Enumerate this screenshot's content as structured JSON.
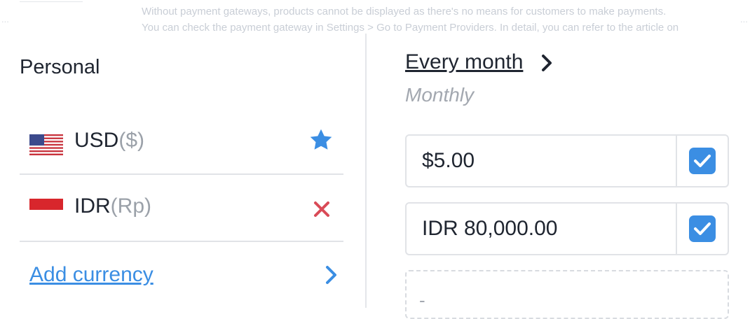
{
  "background": {
    "line1": "Without payment gateways, products cannot be displayed as there's no means for customers to make payments.",
    "line2": "You can check the payment gateway in Settings > Go to Payment Providers. In detail, you can refer to the article on",
    "left_fragment": "...",
    "right_fragment": "..."
  },
  "currencies": {
    "section_title": "Personal",
    "items": [
      {
        "code": "USD",
        "symbol": "($)",
        "flag": "us-flag-icon",
        "action_icon": "star-icon"
      },
      {
        "code": "IDR",
        "symbol": "(Rp)",
        "flag": "indonesia-flag-icon",
        "action_icon": "close-icon"
      }
    ],
    "add_label": "Add currency"
  },
  "billing": {
    "period_label": "Every month",
    "period_sub": "Monthly",
    "prices": [
      {
        "value": "$5.00",
        "checked": true
      },
      {
        "value": "IDR 80,000.00",
        "checked": true
      }
    ],
    "empty_placeholder": "-"
  },
  "colors": {
    "accent": "#3b8ee3",
    "remove": "#d94b57",
    "star": "#3b8ee3"
  }
}
